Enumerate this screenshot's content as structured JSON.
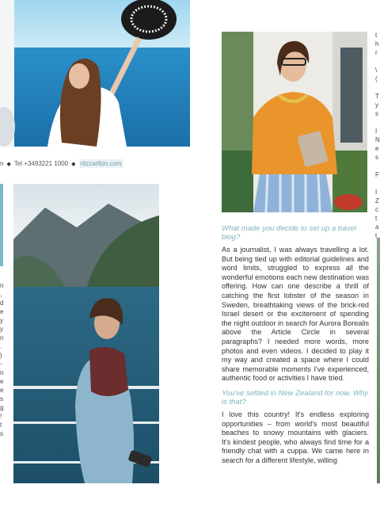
{
  "credit": {
    "lead": "n",
    "tel": "Tel +3493221 1000",
    "link": "ritzcarlton.com"
  },
  "article": {
    "q1": "What made you decide to set up a travel blog?",
    "p1": "As a journalist, I was always travelling a lot. But being tied up with editorial guidelines and word limits, struggled to express all the wonderful emotions each new destination was offering. How can one describe a thrill of catching the first lobster of the season in Sweden, breathtaking views of the brick-red Israel desert or the excitement of spending the night outdoor in search for Aurora Borealis above the Article Circle in several paragraphs? I needed more words, more photos and even videos. I decided to play it my way and created a space where I could share memorable moments I've experienced, authentic food or activities I have tried.",
    "q2": "You've settled in New Zealand for now. Why is that?",
    "p2": "I love this country! It's endless exploring opportunities – from world's most beautiful beaches to snowy mountains with glaciers. It's kindest people, who always find time for a friendly chat with a cuppa. We came here in search for a different lifestyle, willing"
  },
  "left_fragments": [
    "n",
    ",",
    "d",
    "e",
    "y",
    "y",
    "n",
    ".",
    ")",
    "-",
    "n",
    "e",
    "e",
    "s",
    "g",
    "!",
    "t",
    "s"
  ],
  "right_fragments": [
    "t",
    "h",
    "r",
    "",
    "\\",
    "(",
    "",
    "T",
    "y",
    "s",
    "",
    "I",
    "N",
    "e",
    "s",
    "",
    "F",
    "",
    "I",
    "Z",
    "c",
    "t",
    "a",
    "t"
  ]
}
